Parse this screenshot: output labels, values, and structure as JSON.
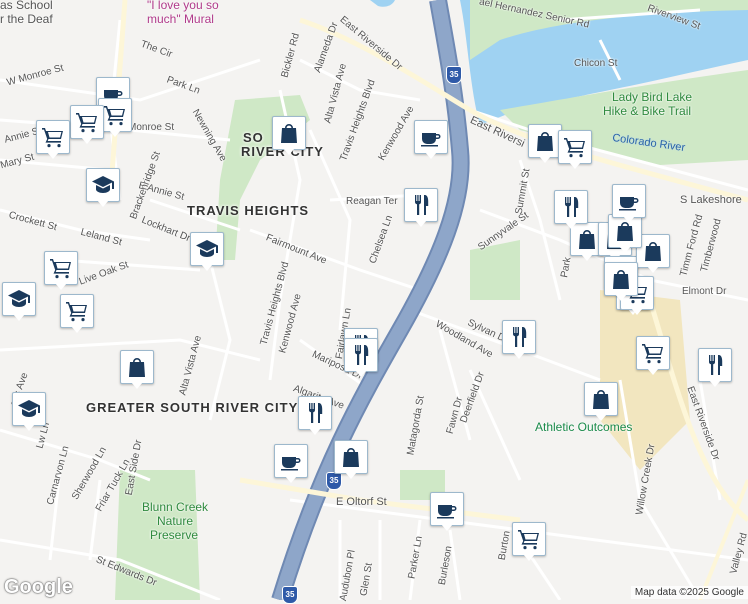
{
  "map": {
    "colors": {
      "land": "#f4f3f1",
      "water": "#9fd2f2",
      "park": "#cfe8c6",
      "highway": "#8ea6c9",
      "highway_casing": "#6f89b3",
      "street": "#ffffff",
      "sand": "#f2e6bf",
      "marker_icon": "#1b3a5c"
    },
    "neighborhoods": [
      "TRAVIS HEIGHTS",
      "GREATER SOUTH RIVER CITY",
      "SO",
      "RIVER CITY",
      "RI"
    ],
    "water_labels": [
      "Colorado River"
    ],
    "poi_labels": {
      "lady_bird_line1": "Lady Bird Lake",
      "lady_bird_line2": "Hike & Bike Trail",
      "athletic": "Athletic Outcomes",
      "blunn_line1": "Blunn Creek",
      "blunn_line2": "Nature",
      "blunn_line3": "Preserve",
      "mural_line1": "\"I love you so",
      "mural_line2": "much\" Mural",
      "school_line1": "as School",
      "school_line2": "r the Deaf"
    },
    "streets": {
      "s0": "East Riverside Dr",
      "s1": "Alameda Dr",
      "s2": "Bickler Rd",
      "s3": "Alta Vista Ave",
      "s4": "Travis Heights Blvd",
      "s5": "Kenwood Ave",
      "s6": "Reagan Ter",
      "s7": "Chelsea Ln",
      "s8": "Fairmount Ave",
      "s9": "Lockhart Dr",
      "s10": "Travis Heights Blvd",
      "s11": "Kenwood Ave",
      "s12": "Fairlawn Ln",
      "s13": "Mariposa Dr",
      "s14": "Algarita Ave",
      "s15": "Alta Vista Ave",
      "s16": "E Oltorf St",
      "s17": "Sylvan Dr",
      "s18": "Woodland Ave",
      "s19": "Deerfield Dr",
      "s20": "Fawn Dr",
      "s21": "Matagorda St",
      "s22": "Sunnyvale St",
      "s23": "Summit St",
      "s24": "East Riversi",
      "s25": "Elmont Dr",
      "s26": "Timberwood",
      "s27": "S Lakeshore",
      "s28": "Riverview St",
      "s29": "Chicon St",
      "s30": "ael Hernandez Senior Rd",
      "s31": "Newning Ave",
      "s32": "Brackenridge St",
      "s33": "E Annie St",
      "s34": "Leland St",
      "s35": "Crockett St",
      "s36": "Live Oak St",
      "s37": "Monroe St",
      "s38": "W Monroe St",
      "s39": "Park Ln",
      "s40": "The Cir",
      "s41": "Annie St",
      "s42": "Mary St",
      "s43": "Sherwood Ln",
      "s44": "Carnarvon Ln",
      "s45": "Friar Tuck Ln",
      "s46": "East Side Dr",
      "s47": "St Edwards Dr",
      "s48": "Audubon Pl",
      "s49": "Glen St",
      "s50": "Parker Ln",
      "s51": "Burleson",
      "s52": "Burton",
      "s53": "Willow Creek Dr",
      "s54": "East Riverside Dr",
      "s55": "Valley Rd",
      "s56": "Timm Ford Rd",
      "s57": "ess Ave",
      "s58": "Lw Ln",
      "s59": "Park"
    },
    "highway_label": "35",
    "markers": [
      {
        "type": "cafe"
      },
      {
        "type": "grocery"
      },
      {
        "type": "grocery"
      },
      {
        "type": "grocery"
      },
      {
        "type": "school"
      },
      {
        "type": "shopping"
      },
      {
        "type": "school"
      },
      {
        "type": "grocery"
      },
      {
        "type": "grocery"
      },
      {
        "type": "school"
      },
      {
        "type": "shopping"
      },
      {
        "type": "school"
      },
      {
        "type": "cafe"
      },
      {
        "type": "restaurant"
      },
      {
        "type": "restaurant"
      },
      {
        "type": "restaurant"
      },
      {
        "type": "restaurant"
      },
      {
        "type": "shopping"
      },
      {
        "type": "cafe"
      },
      {
        "type": "cafe"
      },
      {
        "type": "grocery"
      },
      {
        "type": "shopping"
      },
      {
        "type": "grocery"
      },
      {
        "type": "restaurant"
      },
      {
        "type": "restaurant"
      },
      {
        "type": "shopping"
      },
      {
        "type": "shopping"
      },
      {
        "type": "shopping"
      },
      {
        "type": "grocery"
      },
      {
        "type": "grocery"
      },
      {
        "type": "grocery"
      },
      {
        "type": "grocery"
      },
      {
        "type": "shopping"
      },
      {
        "type": "shopping"
      },
      {
        "type": "cafe"
      },
      {
        "type": "restaurant"
      },
      {
        "type": "shopping"
      }
    ]
  },
  "footer": {
    "logo": "Google",
    "attribution": "Map data ©2025 Google"
  }
}
